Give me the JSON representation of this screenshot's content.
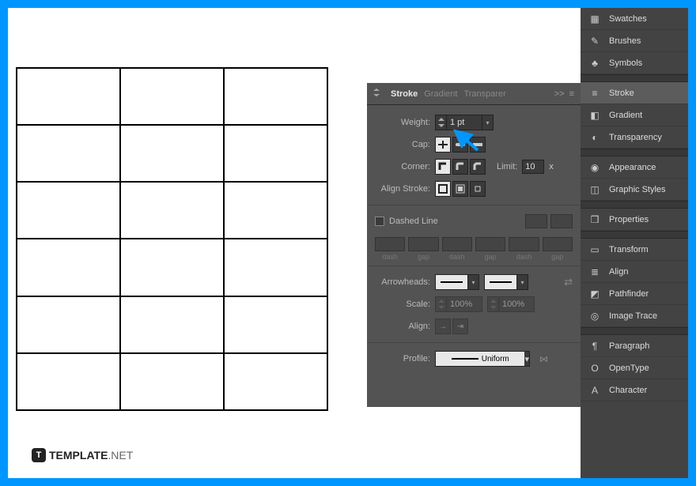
{
  "panel": {
    "tabs": {
      "stroke": "Stroke",
      "gradient": "Gradient",
      "transparency": "Transparer"
    },
    "more": ">>",
    "weight": {
      "label": "Weight:",
      "value": "1 pt"
    },
    "cap": {
      "label": "Cap:"
    },
    "corner": {
      "label": "Corner:",
      "limit_label": "Limit:",
      "limit_value": "10",
      "limit_unit": "x"
    },
    "align": {
      "label": "Align Stroke:"
    },
    "dashed": {
      "label": "Dashed Line"
    },
    "gap_labels": [
      "dash",
      "gap",
      "dash",
      "gap",
      "dash",
      "gap"
    ],
    "arrowheads": {
      "label": "Arrowheads:"
    },
    "scale": {
      "label": "Scale:",
      "value1": "100%",
      "value2": "100%"
    },
    "arrow_align": {
      "label": "Align:"
    },
    "profile": {
      "label": "Profile:",
      "value": "Uniform"
    }
  },
  "sidebar": {
    "items": [
      {
        "label": "Swatches",
        "icon": "swatches-icon"
      },
      {
        "label": "Brushes",
        "icon": "brushes-icon"
      },
      {
        "label": "Symbols",
        "icon": "symbols-icon"
      },
      {
        "label": "Stroke",
        "icon": "stroke-icon",
        "active": true
      },
      {
        "label": "Gradient",
        "icon": "gradient-icon"
      },
      {
        "label": "Transparency",
        "icon": "transparency-icon"
      },
      {
        "label": "Appearance",
        "icon": "appearance-icon"
      },
      {
        "label": "Graphic Styles",
        "icon": "graphic-styles-icon"
      },
      {
        "label": "Properties",
        "icon": "properties-icon"
      },
      {
        "label": "Transform",
        "icon": "transform-icon"
      },
      {
        "label": "Align",
        "icon": "align-icon"
      },
      {
        "label": "Pathfinder",
        "icon": "pathfinder-icon"
      },
      {
        "label": "Image Trace",
        "icon": "image-trace-icon"
      },
      {
        "label": "Paragraph",
        "icon": "paragraph-icon"
      },
      {
        "label": "OpenType",
        "icon": "opentype-icon"
      },
      {
        "label": "Character",
        "icon": "character-icon"
      }
    ]
  },
  "watermark": {
    "brand": "TEMPLATE",
    "suffix": ".NET",
    "icon": "T"
  }
}
